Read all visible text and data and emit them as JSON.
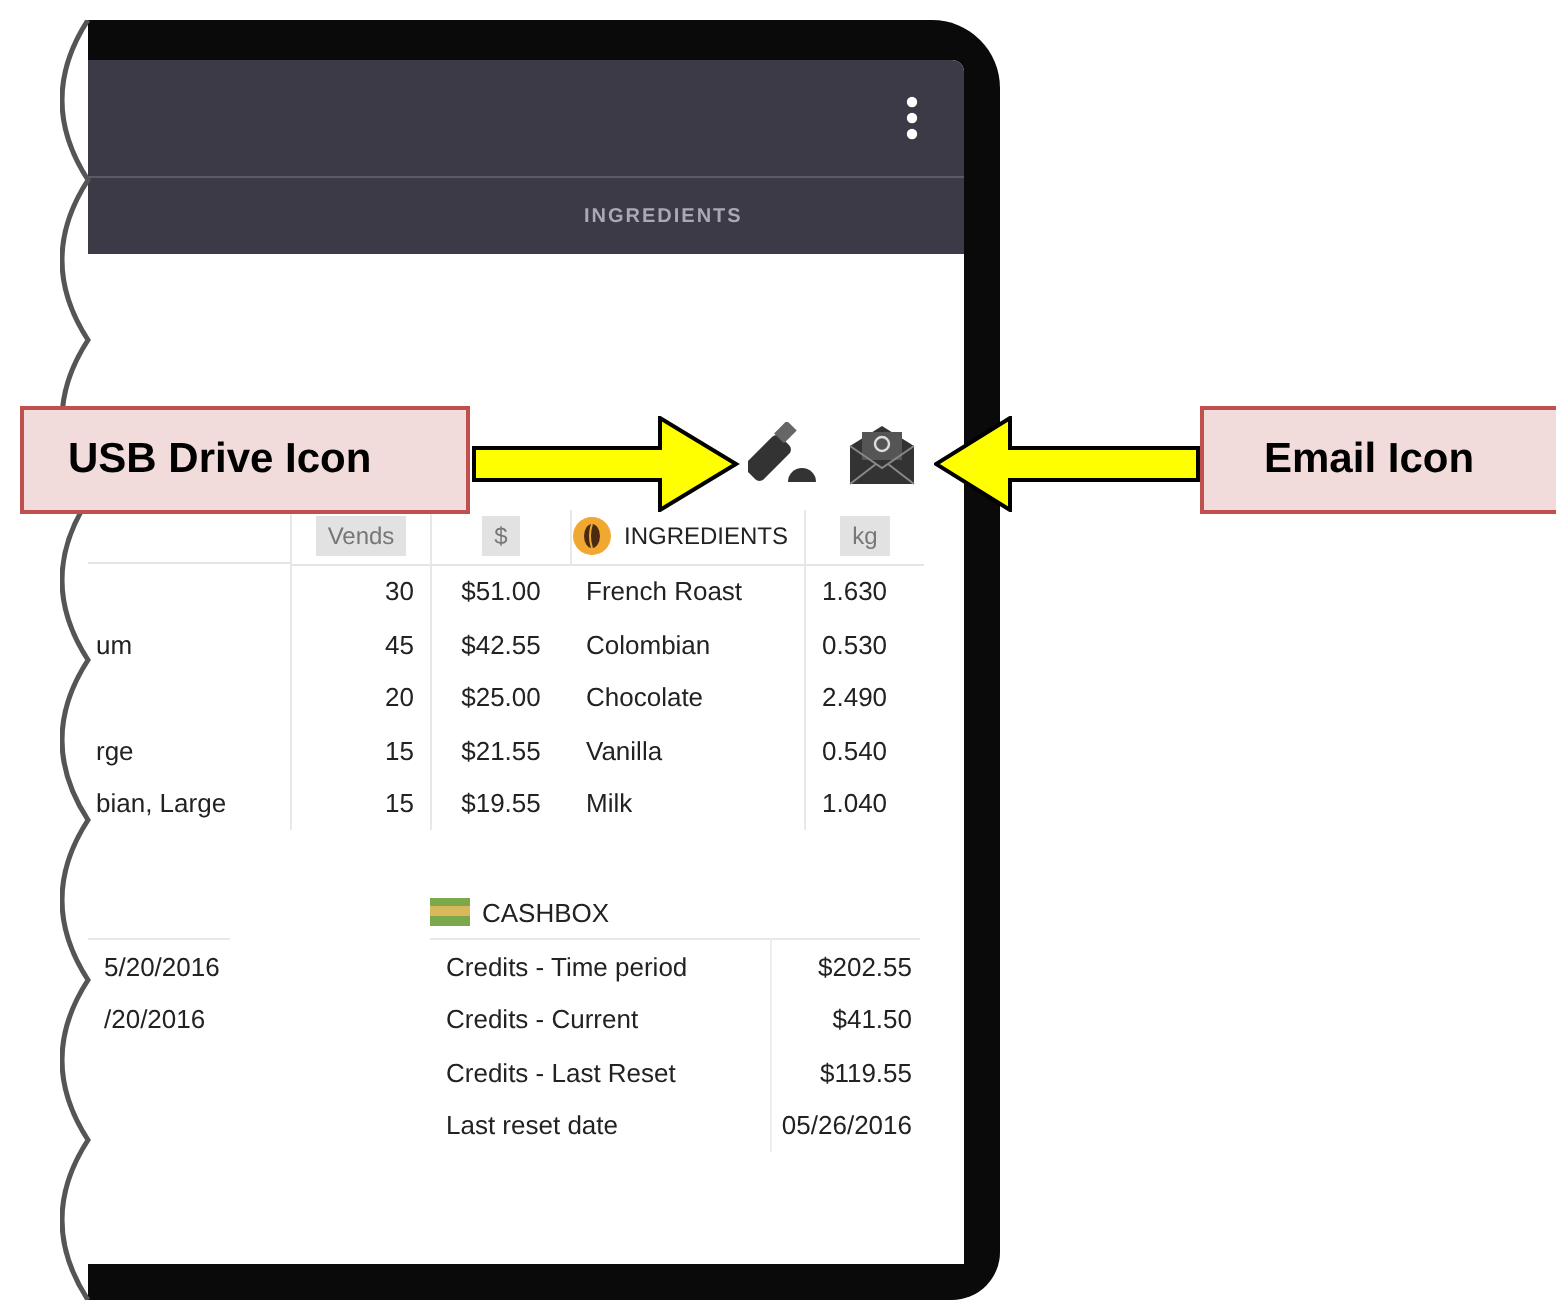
{
  "header": {
    "tab": "INGREDIENTS"
  },
  "table": {
    "columns": [
      "Vends",
      "$",
      "INGREDIENTS",
      "kg"
    ],
    "rows": [
      {
        "vends": "30",
        "amount": "$51.00",
        "ingredient": "French Roast",
        "kg": "1.630"
      },
      {
        "column_1": "um",
        "vends": "45",
        "amount": "$42.55",
        "ingredient": "Colombian",
        "kg": "0.530"
      },
      {
        "vends": "20",
        "amount": "$25.00",
        "ingredient": "Chocolate",
        "kg": "2.490"
      },
      {
        "column_1": "rge",
        "vends": "15",
        "amount": "$21.55",
        "ingredient": "Vanilla",
        "kg": "0.540"
      },
      {
        "column_1": "bian, Large",
        "vends": "15",
        "amount": "$19.55",
        "ingredient": "Milk",
        "kg": "1.040"
      }
    ]
  },
  "dates": [
    "5/20/2016",
    "/20/2016"
  ],
  "cashbox": {
    "title": "CASHBOX",
    "rows": [
      {
        "label": "Credits - Time period",
        "value": "$202.55"
      },
      {
        "label": "Credits - Current",
        "value": "$41.50"
      },
      {
        "label": "Credits - Last Reset",
        "value": "$119.55"
      },
      {
        "label": "Last reset date",
        "value": "05/26/2016"
      }
    ]
  },
  "annotations": [
    {
      "text": "USB Drive Icon",
      "kind": "pointsright"
    },
    {
      "text": "Email Icon",
      "kind": "pointsleft"
    }
  ]
}
